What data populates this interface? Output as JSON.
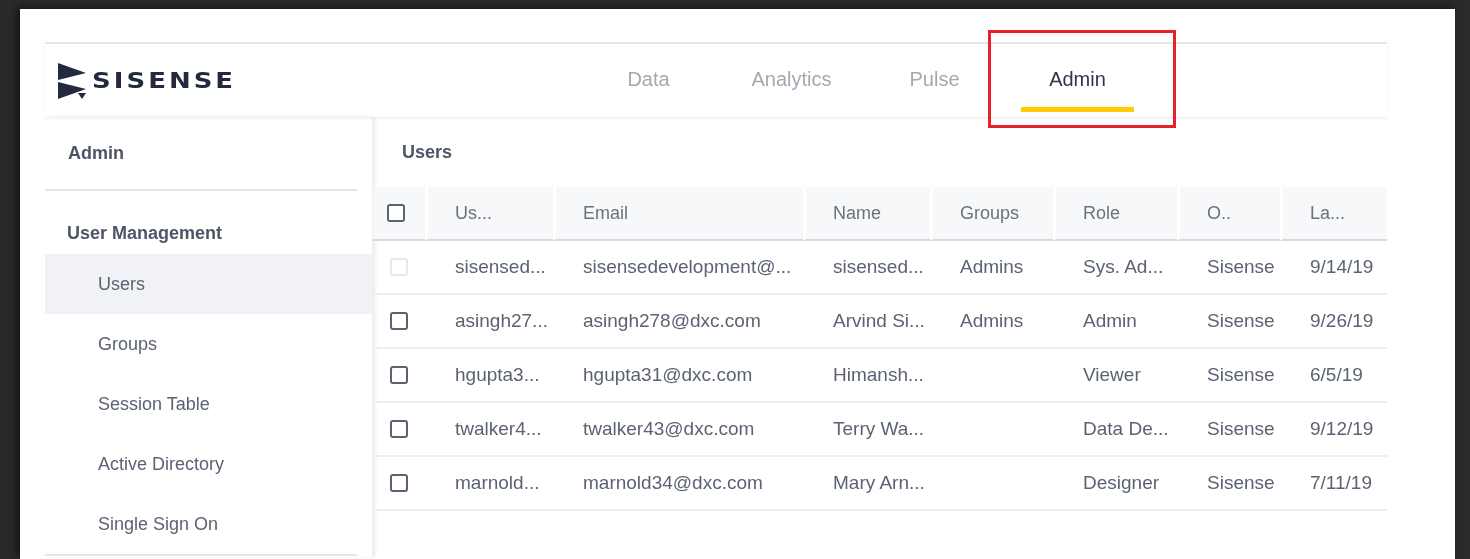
{
  "logo": {
    "text": "SISENSE"
  },
  "nav": [
    {
      "label": "Data",
      "selected": false
    },
    {
      "label": "Analytics",
      "selected": false
    },
    {
      "label": "Pulse",
      "selected": false
    },
    {
      "label": "Admin",
      "selected": true
    }
  ],
  "annotation": {
    "kind": "highlight"
  },
  "sidebar": {
    "title": "Admin",
    "section": "User Management",
    "items": [
      {
        "label": "Users",
        "selected": true
      },
      {
        "label": "Groups",
        "selected": false
      },
      {
        "label": "Session Table",
        "selected": false
      },
      {
        "label": "Active Directory",
        "selected": false
      },
      {
        "label": "Single Sign On",
        "selected": false
      }
    ]
  },
  "content": {
    "title": "Users"
  },
  "table": {
    "select_all": {
      "checked": false
    },
    "columns": [
      "Us...",
      "Email",
      "Name",
      "Groups",
      "Role",
      "O..",
      "La..."
    ],
    "rows": [
      {
        "checked": false,
        "disabled": true,
        "cells": [
          "sisensed...",
          "sisensedevelopment@...",
          "sisensed...",
          "Admins",
          "Sys. Ad...",
          "Sisense",
          "9/14/19"
        ]
      },
      {
        "checked": false,
        "disabled": false,
        "cells": [
          "asingh27...",
          "asingh278@dxc.com",
          "Arvind Si...",
          "Admins",
          "Admin",
          "Sisense",
          "9/26/19"
        ]
      },
      {
        "checked": false,
        "disabled": false,
        "cells": [
          "hgupta3...",
          "hgupta31@dxc.com",
          "Himansh...",
          "",
          "Viewer",
          "Sisense",
          "6/5/19"
        ]
      },
      {
        "checked": false,
        "disabled": false,
        "cells": [
          "twalker4...",
          "twalker43@dxc.com",
          "Terry Wa...",
          "",
          "Data De...",
          "Sisense",
          "9/12/19"
        ]
      },
      {
        "checked": false,
        "disabled": false,
        "cells": [
          "marnold...",
          "marnold34@dxc.com",
          "Mary Arn...",
          "",
          "Designer",
          "Sisense",
          "7/11/19"
        ]
      }
    ]
  }
}
